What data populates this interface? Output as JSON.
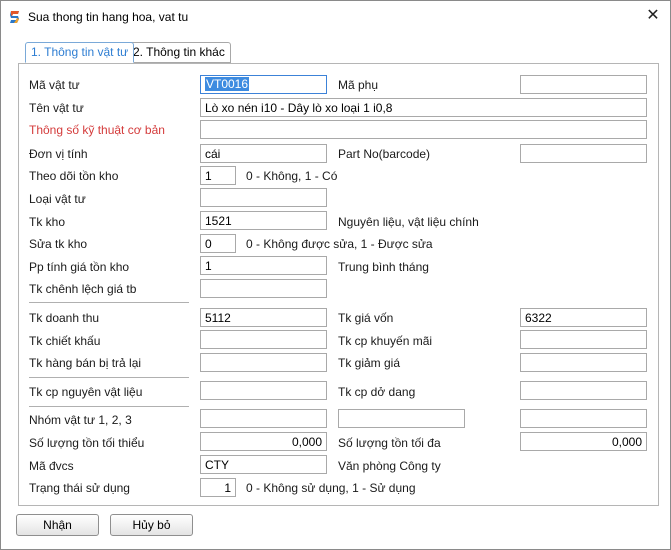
{
  "window": {
    "title": "Sua thong tin hang hoa, vat tu",
    "close_glyph": "✕"
  },
  "tabs": [
    {
      "label": "1. Thông tin vật tư",
      "active": true
    },
    {
      "label": "2. Thông tin khác",
      "active": false
    }
  ],
  "form": {
    "ma_vat_tu": {
      "label": "Mã vật tư",
      "value": "VT0016"
    },
    "ma_phu": {
      "label": "Mã phụ",
      "value": ""
    },
    "ten_vat_tu": {
      "label": "Tên vật tư",
      "value": "Lò xo nén i10 - Dây lò xo loại 1 i0,8"
    },
    "thong_so": {
      "label": "Thông số kỹ thuật cơ bản",
      "value": ""
    },
    "don_vi_tinh": {
      "label": "Đơn vị tính",
      "value": "cái"
    },
    "part_no": {
      "label": "Part No(barcode)",
      "value": ""
    },
    "theo_doi_ton_kho": {
      "label": "Theo dõi tồn kho",
      "value": "1",
      "hint": "0 - Không, 1 - Có"
    },
    "loai_vat_tu": {
      "label": "Loại vật tư",
      "value": ""
    },
    "tk_kho": {
      "label": "Tk kho",
      "value": "1521",
      "hint": "Nguyên liệu, vật liệu chính"
    },
    "sua_tk_kho": {
      "label": "Sửa tk kho",
      "value": "0",
      "hint": "0 - Không được sửa, 1 - Được sửa"
    },
    "pp_tinh_gia": {
      "label": "Pp tính giá tồn kho",
      "value": "1",
      "hint": "Trung bình tháng"
    },
    "tk_chenh_lech": {
      "label": "Tk chênh lệch giá tb",
      "value": ""
    },
    "tk_doanh_thu": {
      "label": "Tk doanh thu",
      "value": "5112"
    },
    "tk_gia_von": {
      "label": "Tk giá vốn",
      "value": "6322"
    },
    "tk_chiet_khau": {
      "label": "Tk chiết khấu",
      "value": ""
    },
    "tk_cp_khuyen_mai": {
      "label": "Tk cp khuyến mãi",
      "value": ""
    },
    "tk_hang_ban_tra_lai": {
      "label": "Tk hàng bán bị trả lại",
      "value": ""
    },
    "tk_giam_gia": {
      "label": "Tk giảm giá",
      "value": ""
    },
    "tk_cp_nguyen_vat_lieu": {
      "label": "Tk cp nguyên vật liệu",
      "value": ""
    },
    "tk_cp_do_dang": {
      "label": "Tk cp dở dang",
      "value": ""
    },
    "nhom_vat_tu": {
      "label": "Nhóm vật tư 1, 2, 3",
      "value1": "",
      "value2": "",
      "value3": ""
    },
    "sl_ton_toi_thieu": {
      "label": "Số lượng tồn tối thiểu",
      "value": "0,000"
    },
    "sl_ton_toi_da": {
      "label": "Số lượng tồn tối đa",
      "value": "0,000"
    },
    "ma_dvcs": {
      "label": "Mã đvcs",
      "value": "CTY",
      "hint": "Văn phòng Công ty"
    },
    "trang_thai": {
      "label": "Trạng thái sử dụng",
      "value": "1",
      "hint": "0 - Không sử dụng, 1 - Sử dụng"
    }
  },
  "buttons": {
    "ok": "Nhận",
    "cancel": "Hủy bỏ"
  },
  "icons": {
    "app": "app-logo-icon",
    "close": "close-icon"
  }
}
